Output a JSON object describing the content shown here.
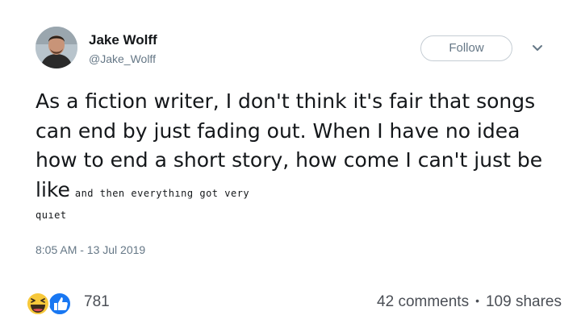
{
  "profile": {
    "name": "Jake Wolff",
    "handle": "@Jake_Wolff"
  },
  "header": {
    "follow_label": "Follow",
    "more_icon": "chevron-down-icon"
  },
  "tweet": {
    "text_main": "As a fiction writer, I don't think it's fair that songs can end by just fading out. When I have no idea how to end a short story, how come I can't just be like",
    "text_small_1": "and then everythıng got very",
    "text_small_2": "quıet",
    "timestamp": "8:05 AM - 13 Jul 2019"
  },
  "footer": {
    "reaction_icons": [
      "haha-emoji-icon",
      "like-thumb-icon"
    ],
    "reaction_count": "781",
    "comments": "42 comments",
    "separator": "•",
    "shares": "109 shares"
  },
  "colors": {
    "text": "#14171a",
    "muted": "#657786",
    "like_blue": "#1877f2",
    "haha_yellow": "#f7c83a"
  }
}
